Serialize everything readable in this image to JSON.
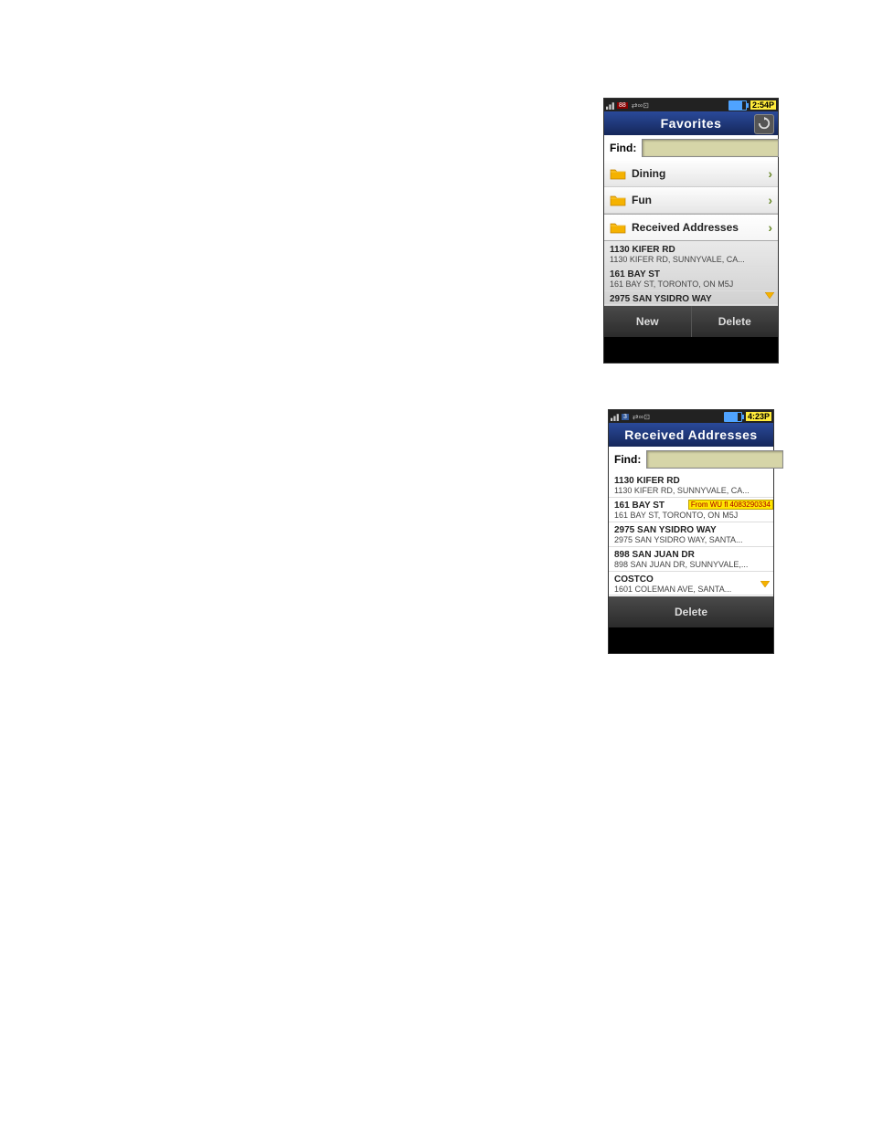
{
  "phone1": {
    "status": {
      "time": "2:54P"
    },
    "title": "Favorites",
    "find_label": "Find:",
    "find_value": "",
    "categories": [
      {
        "label": "Dining"
      },
      {
        "label": "Fun"
      },
      {
        "label": "Received Addresses",
        "selected": true
      }
    ],
    "addresses": [
      {
        "l1": "1130 KIFER RD",
        "l2": "1130 KIFER RD, SUNNYVALE, CA..."
      },
      {
        "l1": "161 BAY ST",
        "l2": "161 BAY ST, TORONTO, ON M5J"
      },
      {
        "l1": "2975 SAN YSIDRO WAY",
        "l2": ""
      }
    ],
    "buttons": {
      "new": "New",
      "delete": "Delete"
    }
  },
  "phone2": {
    "status": {
      "time": "4:23P"
    },
    "title": "Received Addresses",
    "find_label": "Find:",
    "find_value": "",
    "addresses": [
      {
        "l1": "1130 KIFER RD",
        "l2": "1130 KIFER RD, SUNNYVALE, CA..."
      },
      {
        "l1": "161 BAY ST",
        "l2": "161 BAY ST, TORONTO, ON M5J",
        "tag": "From WU fl 4083290334"
      },
      {
        "l1": "2975 SAN YSIDRO WAY",
        "l2": "2975 SAN YSIDRO WAY, SANTA..."
      },
      {
        "l1": "898 SAN JUAN DR",
        "l2": "898 SAN JUAN DR, SUNNYVALE,..."
      },
      {
        "l1": "COSTCO",
        "l2": "1601 COLEMAN AVE, SANTA..."
      }
    ],
    "buttons": {
      "delete": "Delete"
    }
  }
}
